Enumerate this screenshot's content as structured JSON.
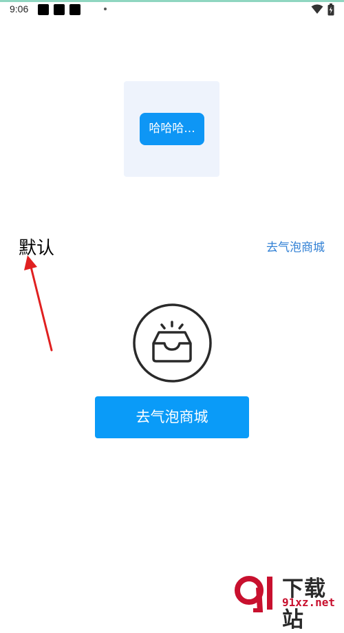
{
  "status_bar": {
    "time": "9:06",
    "icons": [
      "notification-icon",
      "notification-icon",
      "notification-icon",
      "dot-icon",
      "wifi-icon",
      "battery-icon"
    ]
  },
  "bubble_preview": {
    "bubble_text": "哈哈哈..."
  },
  "style_label": "默认",
  "mall_link_label": "去气泡商城",
  "empty_state_icon": "empty-box-icon",
  "mall_button_label": "去气泡商城",
  "annotation": {
    "arrow_color": "#e02020"
  },
  "watermark": {
    "brand": "下载站",
    "url": "91xz.net"
  },
  "colors": {
    "accent": "#0a9bf8",
    "link": "#2f7fd4",
    "preview_bg": "#eef3fc"
  }
}
